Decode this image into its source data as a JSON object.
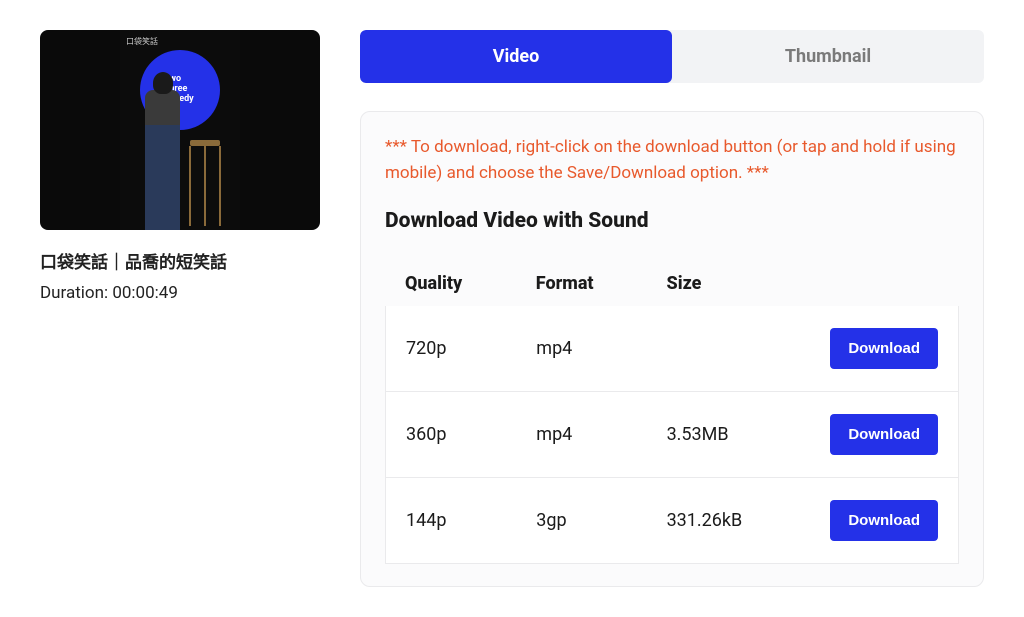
{
  "video": {
    "title": "口袋笑話｜品喬的短笑話",
    "duration_label": "Duration: 00:00:49",
    "thumb_logo_text": "two\nthree\nomedy",
    "thumb_watermark": "口袋笑話"
  },
  "tabs": {
    "video": "Video",
    "thumbnail": "Thumbnail"
  },
  "help_text": "*** To download, right-click on the download button (or tap and hold if using mobile) and choose the Save/Download option. ***",
  "section_title": "Download Video with Sound",
  "table": {
    "headers": {
      "quality": "Quality",
      "format": "Format",
      "size": "Size"
    },
    "rows": [
      {
        "quality": "720p",
        "format": "mp4",
        "size": "",
        "button": "Download"
      },
      {
        "quality": "360p",
        "format": "mp4",
        "size": "3.53MB",
        "button": "Download"
      },
      {
        "quality": "144p",
        "format": "3gp",
        "size": "331.26kB",
        "button": "Download"
      }
    ]
  }
}
